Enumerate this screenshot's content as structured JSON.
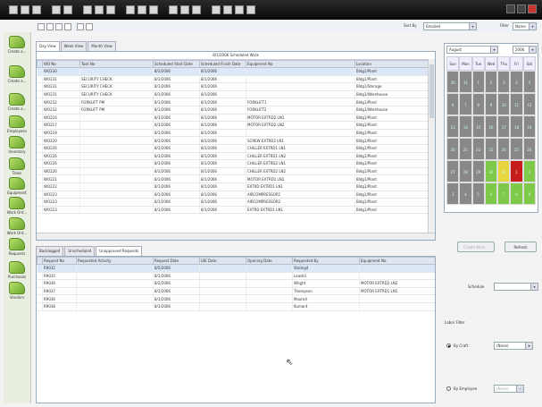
{
  "toolbar": {
    "sort_by_label": "Sort By",
    "sort_by_value": "Emailed",
    "filter_label": "Filter",
    "filter_value": "Name"
  },
  "sidebar": {
    "items": [
      {
        "label": "Create a..."
      },
      {
        "label": "Create a..."
      },
      {
        "label": "Create a..."
      },
      {
        "label": "Employees"
      },
      {
        "label": "Inventory"
      },
      {
        "label": "Tasks"
      },
      {
        "label": "Equipment"
      },
      {
        "label": "Work Ord..."
      },
      {
        "label": "Work Ord..."
      },
      {
        "label": "Requests"
      },
      {
        "label": "Purchases"
      },
      {
        "label": "Vendors"
      }
    ]
  },
  "top_tabs": [
    "Day View",
    "Week View",
    "Month View"
  ],
  "top_grid": {
    "title": "8/1/2006 Scheduled Work",
    "columns": [
      "WO No",
      "Task No",
      "Scheduled Start Date",
      "Scheduled Finish Date",
      "Equipment No",
      "Location"
    ],
    "rows": [
      [
        "WO230",
        "",
        "8/1/2006",
        "8/1/2006",
        "",
        "Bldg1/Plant"
      ],
      [
        "WO231",
        "SECURITY CHECK",
        "8/1/2006",
        "8/1/2006",
        "",
        "Bldg1/Plant"
      ],
      [
        "WO231",
        "SECURITY CHECK",
        "8/1/2006",
        "8/1/2006",
        "",
        "Bldg1/Storage"
      ],
      [
        "WO231",
        "SECURITY CHECK",
        "8/1/2006",
        "8/1/2006",
        "",
        "Bldg1/Warehouse"
      ],
      [
        "WO232",
        "FORKLIFT PM",
        "8/1/2006",
        "8/1/2006",
        "FORKLIFT1",
        "Bldg1/Plant"
      ],
      [
        "WO232",
        "FORKLIFT PM",
        "8/1/2006",
        "8/1/2006",
        "FORKLIFT2",
        "Bldg1/Warehouse"
      ],
      [
        "WO216",
        "",
        "8/1/2006",
        "8/1/2006",
        "MOTOR EXTRD2 LN1",
        "Bldg1/Plant"
      ],
      [
        "WO217",
        "",
        "8/1/2006",
        "8/1/2006",
        "MOTOR EXTRD2 LN2",
        "Bldg1/Plant"
      ],
      [
        "WO219",
        "",
        "8/1/2006",
        "8/1/2006",
        "",
        "Bldg1/Plant"
      ],
      [
        "WO220",
        "",
        "8/1/2006",
        "8/1/2006",
        "SCREW EXTRD2 LN1",
        "Bldg1/Plant"
      ],
      [
        "WO226",
        "",
        "8/1/2006",
        "8/1/2006",
        "CHILLER EXTRD1 LN1",
        "Bldg1/Plant"
      ],
      [
        "WO226",
        "",
        "8/1/2006",
        "8/1/2006",
        "CHILLER EXTRD1 LN2",
        "Bldg1/Plant"
      ],
      [
        "WO226",
        "",
        "8/1/2006",
        "8/1/2006",
        "CHILLER EXTRD2 LN1",
        "Bldg1/Plant"
      ],
      [
        "WO226",
        "",
        "8/1/2006",
        "8/1/2006",
        "CHILLER EXTRD2 LN2",
        "Bldg1/Plant"
      ],
      [
        "WO221",
        "",
        "8/1/2006",
        "8/1/2006",
        "MOTOR EXTRD1 LN2",
        "Bldg1/Plant"
      ],
      [
        "WO222",
        "",
        "8/1/2006",
        "8/1/2006",
        "EXTRD EXTRD1 LN1",
        "Bldg1/Plant"
      ],
      [
        "WO223",
        "",
        "8/1/2006",
        "8/1/2006",
        "AIRCOMPRESSOR1",
        "Bldg1/Plant"
      ],
      [
        "WO223",
        "",
        "8/1/2006",
        "8/1/2006",
        "AIRCOMPRESSOR2",
        "Bldg1/Plant"
      ],
      [
        "WO223",
        "",
        "8/1/2006",
        "8/1/2006",
        "EXTRD EXTRD1 LN1",
        "Bldg1/Plant"
      ]
    ]
  },
  "calendar": {
    "month": "August",
    "year": "2006",
    "day_headers": [
      "Sun",
      "Mon",
      "Tue",
      "Wed",
      "Thu",
      "Fri",
      "Sat"
    ],
    "weeks": [
      [
        "30",
        "31",
        "1",
        "2",
        "3",
        "4",
        "5"
      ],
      [
        "6",
        "7",
        "8",
        "9",
        "10",
        "11",
        "12"
      ],
      [
        "13",
        "14",
        "15",
        "16",
        "17",
        "18",
        "19"
      ],
      [
        "20",
        "21",
        "22",
        "23",
        "24",
        "25",
        "26"
      ],
      [
        "27",
        "28",
        "29",
        "30",
        "31",
        "1",
        "2"
      ],
      [
        "3",
        "4",
        "5",
        "6",
        "7",
        "8",
        "9"
      ]
    ]
  },
  "buttons": {
    "create_wo": "Create Work...",
    "refresh": "Refresh"
  },
  "bottom_tabs": [
    "Backlogged",
    "Unscheduled",
    "Unapproved Requests"
  ],
  "bottom_grid": {
    "columns": [
      "Request No",
      "Requested Activity",
      "Request Date",
      "UIE Date",
      "Opening Date",
      "Requested By",
      "Equipment No"
    ],
    "rows": [
      [
        "R9032",
        "",
        "8/5/2006",
        "",
        "",
        "Staling4",
        ""
      ],
      [
        "R9035",
        "",
        "8/1/2006",
        "",
        "",
        "Leads1",
        ""
      ],
      [
        "R9036",
        "",
        "8/2/2006",
        "",
        "",
        "Wright",
        "MOTOR EXTRD2 LN2"
      ],
      [
        "R9037",
        "",
        "8/1/2006",
        "",
        "",
        "Thompson",
        "MOTOR EXTRD1 LN1"
      ],
      [
        "R9036",
        "",
        "8/1/2006",
        "",
        "",
        "Moore4",
        ""
      ],
      [
        "R9038",
        "",
        "8/1/2006",
        "",
        "",
        "Kumar4",
        ""
      ]
    ]
  },
  "right_panel": {
    "schedule_label": "Schedule",
    "labor_filter_label": "Labor Filter",
    "by_craft_label": "By Craft",
    "by_craft_value": "(None)",
    "by_employee_label": "By Employee",
    "by_employee_value": "(None)"
  },
  "colors": {
    "titlebar": "#111111",
    "sidebar_icon": "#8cc63f",
    "cal_green": "#7ec94a",
    "cal_yellow": "#e8d640",
    "cal_red": "#c61c1c"
  }
}
